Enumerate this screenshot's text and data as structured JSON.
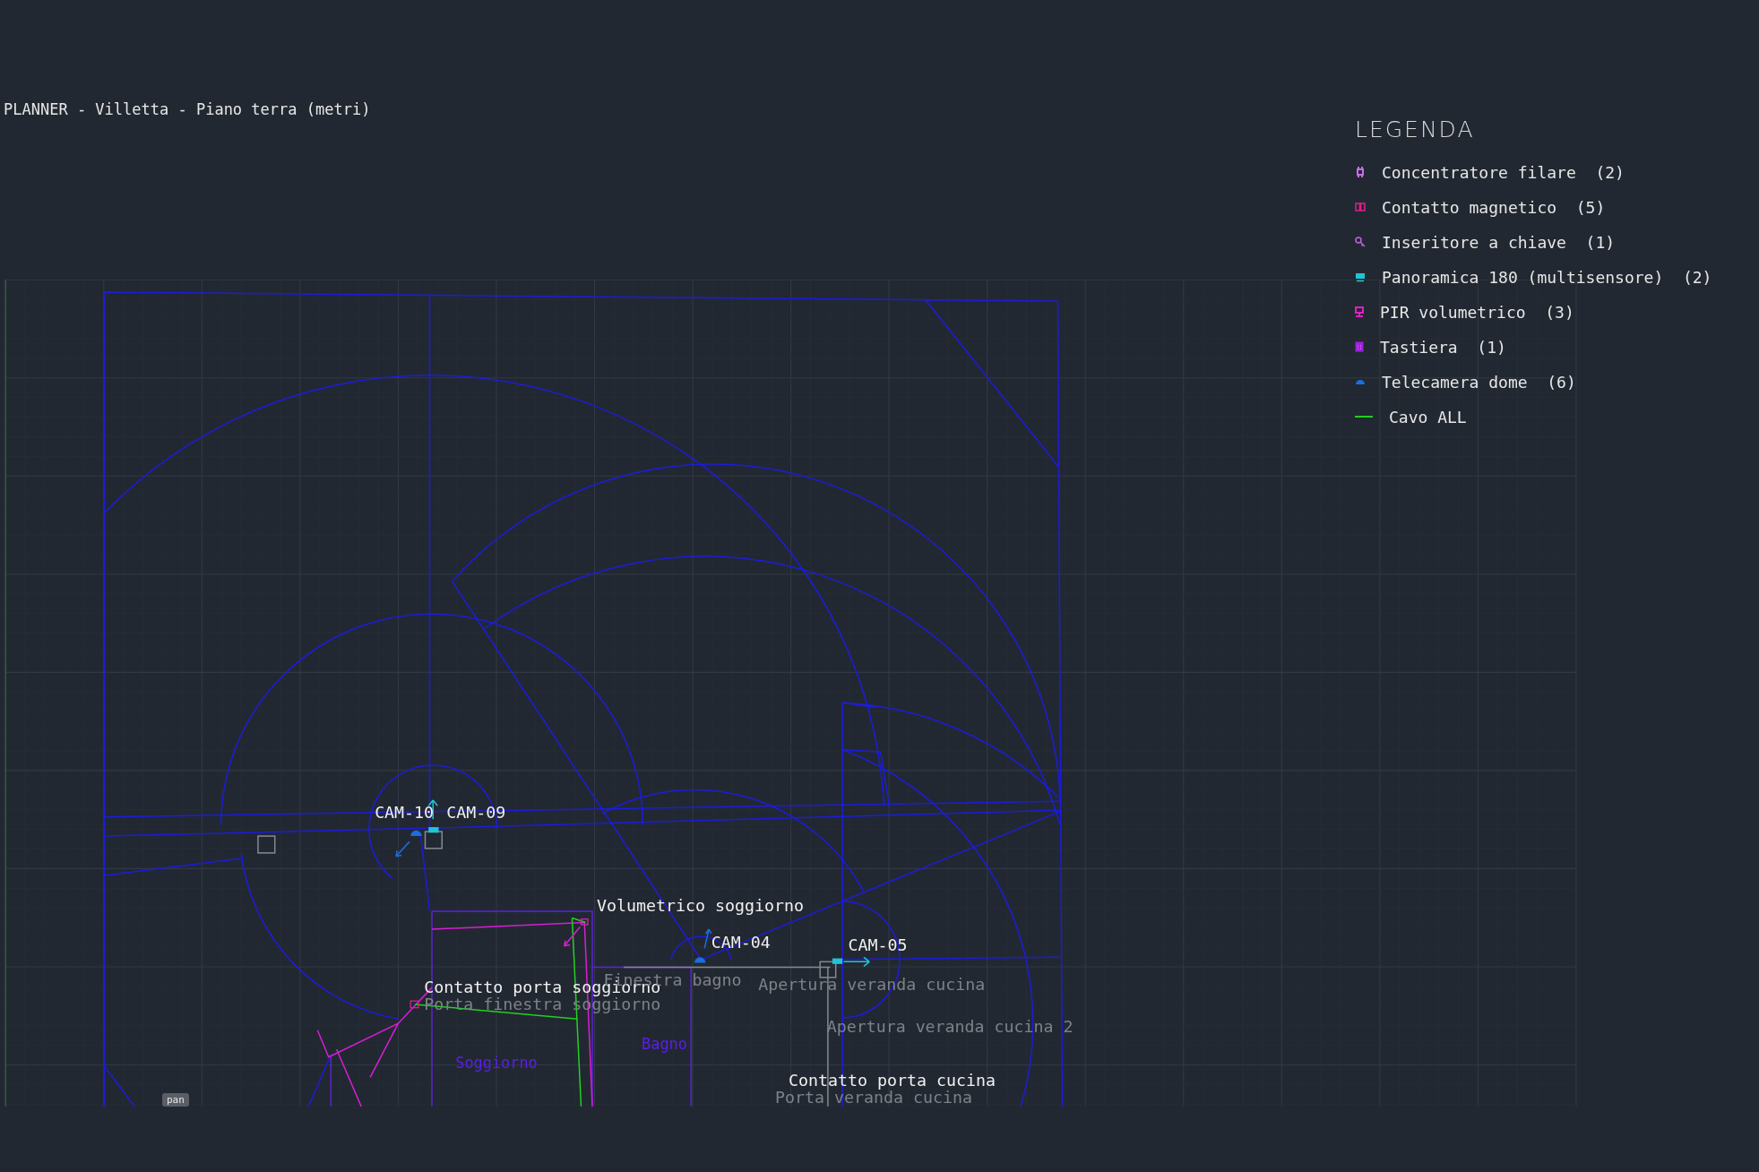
{
  "title": "PLANNER - Villetta - Piano terra (metri)",
  "legend": {
    "title": "LEGENDA",
    "items": [
      {
        "kind": "hub",
        "label": "Concentratore filare  (2)",
        "color": "#c46ee6"
      },
      {
        "kind": "contact",
        "label": "Contatto magnetico  (5)",
        "color": "#e0208a"
      },
      {
        "kind": "key",
        "label": "Inseritore a chiave  (1)",
        "color": "#c062e0"
      },
      {
        "kind": "panoramic",
        "label": "Panoramica 180 (multisensore)  (2)",
        "color": "#20c4d4"
      },
      {
        "kind": "pir",
        "label": "PIR volumetrico  (3)",
        "color": "#e020c4"
      },
      {
        "kind": "keypad",
        "label": "Tastiera  (1)",
        "color": "#a020e0"
      },
      {
        "kind": "dome",
        "label": "Telecamera dome  (6)",
        "color": "#1a6ee0"
      },
      {
        "kind": "cable",
        "label": "Cavo ALL",
        "color": "#20d020"
      }
    ]
  },
  "plan": {
    "labels": [
      {
        "kind": "device",
        "text": "CAM-10"
      },
      {
        "kind": "device",
        "text": "CAM-09"
      },
      {
        "kind": "device",
        "text": "Volumetrico soggiorno"
      },
      {
        "kind": "device",
        "text": "CAM-04"
      },
      {
        "kind": "device",
        "text": "CAM-05"
      },
      {
        "kind": "device",
        "text": "Contatto porta soggiorno"
      },
      {
        "kind": "opening",
        "text": "Finestra bagno"
      },
      {
        "kind": "opening",
        "text": "Apertura veranda cucina"
      },
      {
        "kind": "opening",
        "text": "Porta finestra soggiorno"
      },
      {
        "kind": "opening",
        "text": "Apertura veranda cucina 2"
      },
      {
        "kind": "room",
        "text": "Bagno"
      },
      {
        "kind": "room",
        "text": "Soggiorno"
      },
      {
        "kind": "device",
        "text": "Contatto porta cucina"
      },
      {
        "kind": "opening",
        "text": "Porta veranda cucina"
      }
    ]
  },
  "tag": "pan"
}
